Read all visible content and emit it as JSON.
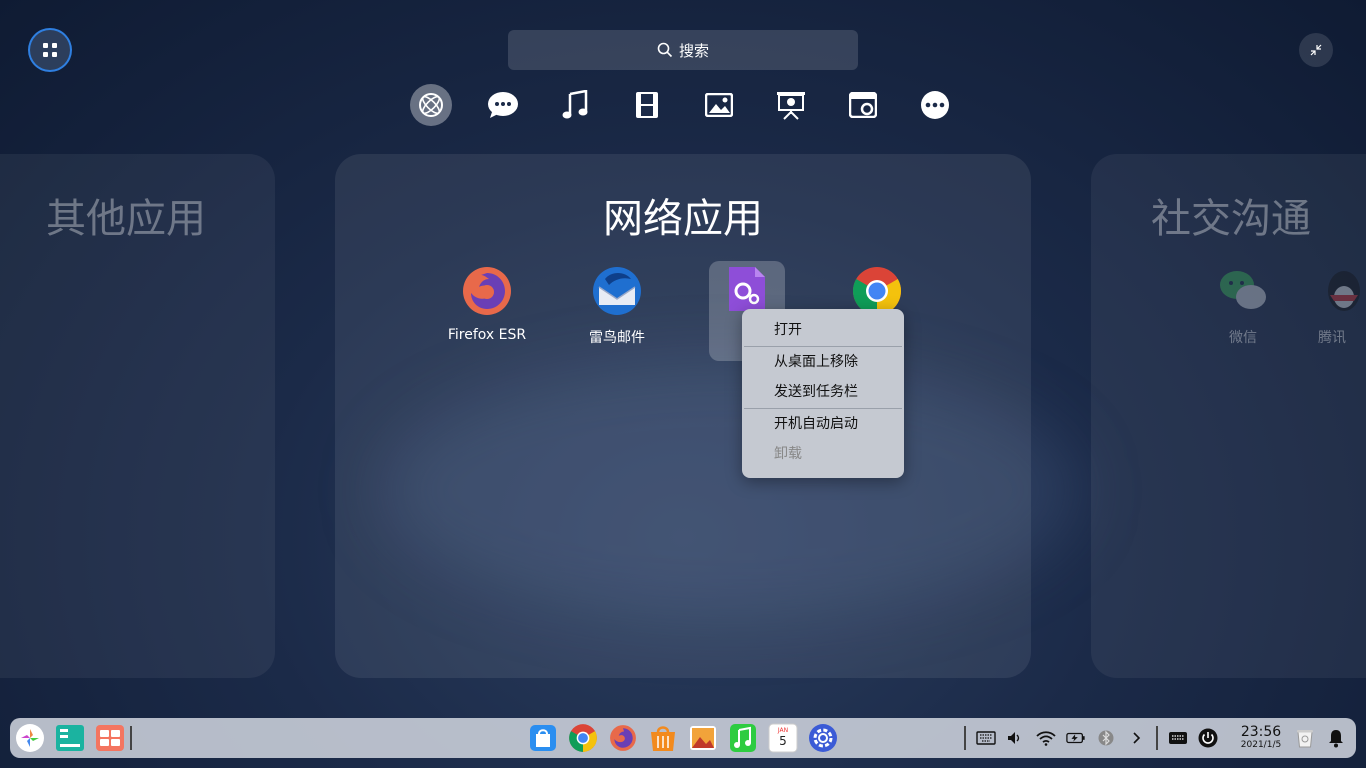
{
  "search": {
    "label": "搜索",
    "icon": "search-icon"
  },
  "categories": [
    {
      "name": "internet",
      "icon": "internet-icon",
      "active": true
    },
    {
      "name": "chat",
      "icon": "chat-icon"
    },
    {
      "name": "music",
      "icon": "music-icon"
    },
    {
      "name": "video",
      "icon": "video-icon"
    },
    {
      "name": "image",
      "icon": "image-icon"
    },
    {
      "name": "office",
      "icon": "presentation-icon"
    },
    {
      "name": "developer",
      "icon": "developer-icon"
    },
    {
      "name": "more",
      "icon": "more-icon"
    }
  ],
  "panels": {
    "left": {
      "title": "其他应用"
    },
    "center": {
      "title": "网络应用",
      "apps": [
        {
          "label": "Firefox ESR",
          "icon": "firefox-icon"
        },
        {
          "label": "雷鸟邮件",
          "icon": "thunderbird-icon"
        },
        {
          "label": "",
          "icon": "settings-app-icon",
          "selected": true
        },
        {
          "label": "",
          "icon": "chrome-icon"
        }
      ]
    },
    "right": {
      "title": "社交沟通",
      "apps": [
        {
          "label": "微信",
          "icon": "wechat-icon"
        },
        {
          "label": "腾讯",
          "icon": "qq-icon"
        }
      ]
    }
  },
  "context_menu": {
    "items": [
      {
        "label": "打开",
        "enabled": true
      },
      {
        "label": "从桌面上移除",
        "enabled": true
      },
      {
        "label": "发送到任务栏",
        "enabled": true
      },
      {
        "label": "开机自动启动",
        "enabled": true
      },
      {
        "label": "卸载",
        "enabled": false
      }
    ]
  },
  "dock": {
    "clock": {
      "time": "23:56",
      "date": "2021/1/5"
    },
    "calendar": {
      "month": "JAN",
      "day": "5"
    }
  },
  "colors": {
    "accent": "#2f7fe0",
    "menu_bg": "#c5c9d1"
  }
}
